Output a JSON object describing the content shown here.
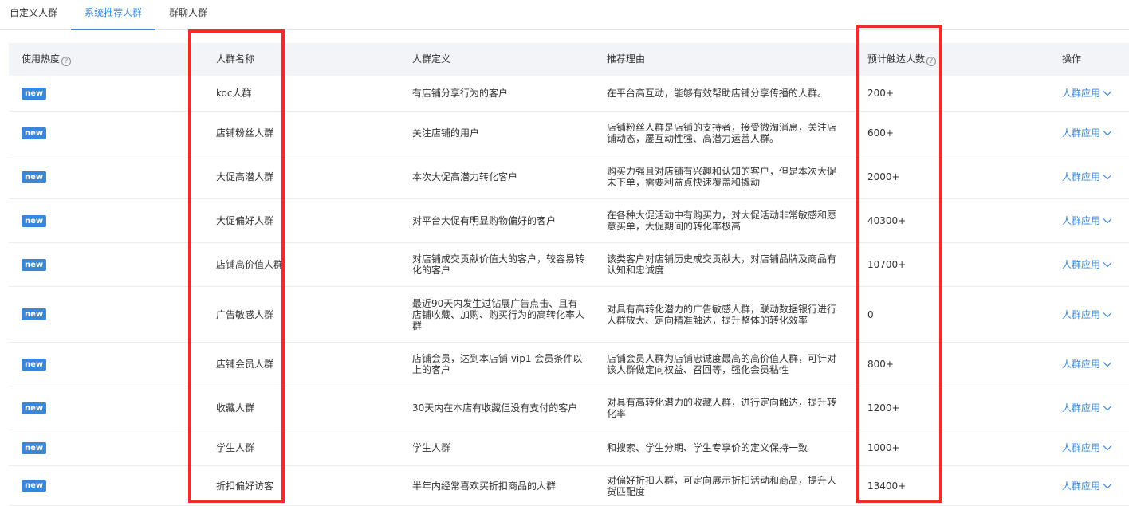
{
  "tabs": [
    {
      "label": "自定义人群",
      "active": false
    },
    {
      "label": "系统推荐人群",
      "active": true
    },
    {
      "label": "群聊人群",
      "active": false
    }
  ],
  "table": {
    "headers": [
      "使用热度",
      "人群名称",
      "人群定义",
      "推荐理由",
      "预计触达人数",
      "操作"
    ],
    "help_icon_glyph": "?",
    "rows": [
      {
        "badge": "new",
        "name": "koc人群",
        "definition": "有店铺分享行为的客户",
        "reason": "在平台高互动，能够有效帮助店铺分享传播的人群。",
        "reach": "200+",
        "action": "人群应用"
      },
      {
        "badge": "new",
        "name": "店铺粉丝人群",
        "definition": "关注店铺的用户",
        "reason": "店铺粉丝人群是店铺的支持者，接受微淘消息，关注店铺动态，屡互动性强、高潜力运营人群。",
        "reach": "600+",
        "action": "人群应用"
      },
      {
        "badge": "new",
        "name": "大促高潜人群",
        "definition": "本次大促高潜力转化客户",
        "reason": "购买力强且对店铺有兴趣和认知的客户，但是本次大促未下单，需要利益点快速覆盖和撬动",
        "reach": "2000+",
        "action": "人群应用"
      },
      {
        "badge": "new",
        "name": "大促偏好人群",
        "definition": "对平台大促有明显购物偏好的客户",
        "reason": "在各种大促活动中有购买力，对大促活动非常敏感和愿意买单，大促期间的转化率极高",
        "reach": "40300+",
        "action": "人群应用"
      },
      {
        "badge": "new",
        "name": "店铺高价值人群",
        "definition": "对店铺成交贡献价值大的客户，较容易转化的客户",
        "reason": "该类客户对店铺历史成交贡献大，对店铺品牌及商品有认知和忠诚度",
        "reach": "10700+",
        "action": "人群应用"
      },
      {
        "badge": "new",
        "name": "广告敏感人群",
        "definition": "最近90天内发生过钻展广告点击、且有店铺收藏、加购、购买行为的高转化率人群",
        "reason": "对具有高转化潜力的广告敏感人群，联动数据银行进行人群放大、定向精准触达，提升整体的转化效率",
        "reach": "0",
        "action": "人群应用"
      },
      {
        "badge": "new",
        "name": "店铺会员人群",
        "definition": "店铺会员，达到本店铺 vip1 会员条件以上的客户",
        "reason": "店铺会员人群为店铺忠诚度最高的高价值人群，可针对该人群做定向权益、召回等，强化会员粘性",
        "reach": "800+",
        "action": "人群应用"
      },
      {
        "badge": "new",
        "name": "收藏人群",
        "definition": "30天内在本店有收藏但没有支付的客户",
        "reason": "对具有高转化潜力的收藏人群，进行定向触达，提升转化率",
        "reach": "1200+",
        "action": "人群应用"
      },
      {
        "badge": "new",
        "name": "学生人群",
        "definition": "学生人群",
        "reason": "和搜索、学生分期、学生专享价的定义保持一致",
        "reach": "1000+",
        "action": "人群应用"
      },
      {
        "badge": "new",
        "name": "折扣偏好访客",
        "definition": "半年内经常喜欢买折扣商品的人群",
        "reason": "对偏好折扣人群，可定向展示折扣活动和商品，提升人货匹配度",
        "reach": "13400+",
        "action": "人群应用"
      }
    ]
  },
  "colors": {
    "accent": "#3a86d8",
    "highlight": "#ee2c2c",
    "header_bg": "#f3f4f7"
  }
}
